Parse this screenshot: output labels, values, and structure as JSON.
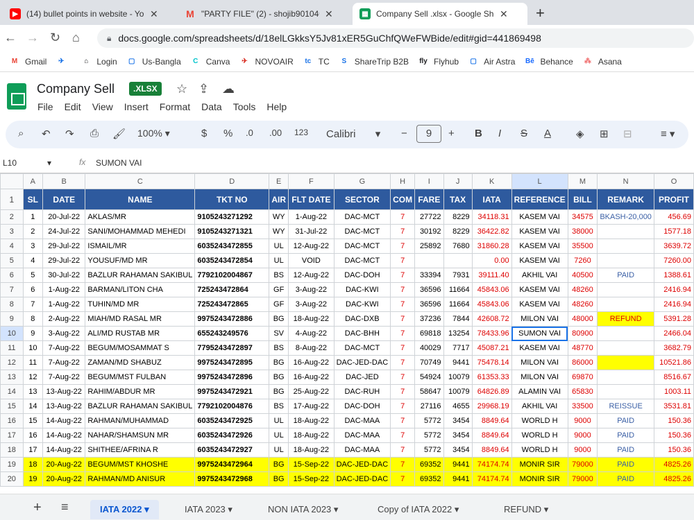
{
  "browser": {
    "tabs": [
      {
        "title": "(14) bullet points in website - Yo",
        "color": "#ff0000",
        "icon": "youtube-icon",
        "glyph": "▶"
      },
      {
        "title": "\"PARTY FILE\" (2) - shojib9010400",
        "color": "#ea4335",
        "icon": "gmail-icon",
        "glyph": "M"
      },
      {
        "title": "Company Sell .xlsx - Google She",
        "color": "#0f9d58",
        "icon": "sheets-icon",
        "glyph": "▦"
      }
    ],
    "url": "docs.google.com/spreadsheets/d/18elLGkksY5Jv81xER5GuChfQWeFWBide/edit#gid=441869498",
    "bookmarks": [
      {
        "label": "Gmail",
        "glyph": "M",
        "color": "#ea4335"
      },
      {
        "label": "",
        "glyph": "✈",
        "color": "#1a73e8"
      },
      {
        "label": "Login",
        "glyph": "⌂",
        "color": "#202124"
      },
      {
        "label": "Us-Bangla",
        "glyph": "▢",
        "color": "#1a73e8"
      },
      {
        "label": "Canva",
        "glyph": "C",
        "color": "#00c4cc"
      },
      {
        "label": "NOVOAIR",
        "glyph": "✈",
        "color": "#d93025"
      },
      {
        "label": "TC",
        "glyph": "tc",
        "color": "#1a73e8"
      },
      {
        "label": "ShareTrip B2B",
        "glyph": "S",
        "color": "#1a73e8"
      },
      {
        "label": "Flyhub",
        "glyph": "fly",
        "color": "#202124"
      },
      {
        "label": "Air Astra",
        "glyph": "▢",
        "color": "#1a73e8"
      },
      {
        "label": "Behance",
        "glyph": "Bē",
        "color": "#1769ff"
      },
      {
        "label": "Asana",
        "glyph": "⁂",
        "color": "#f06a6a"
      }
    ]
  },
  "doc": {
    "title": "Company Sell",
    "badge": ".XLSX",
    "menu": [
      "File",
      "Edit",
      "View",
      "Insert",
      "Format",
      "Data",
      "Tools",
      "Help"
    ]
  },
  "toolbar": {
    "zoom": "100%",
    "currency": "$",
    "percent": "%",
    "dec_less": ".0",
    "dec_more": ".00",
    "format_123": "123",
    "font": "Calibri",
    "font_size": "9"
  },
  "formula_bar": {
    "cell_ref": "L10",
    "fx": "fx",
    "value": "SUMON VAI"
  },
  "sheet": {
    "columns": [
      "A",
      "B",
      "C",
      "D",
      "E",
      "F",
      "G",
      "H",
      "I",
      "J",
      "K",
      "L",
      "M",
      "N",
      "O"
    ],
    "header_row": [
      "SL",
      "DATE",
      "NAME",
      "TKT NO",
      "AIR",
      "FLT DATE",
      "SECTOR",
      "COM",
      "FARE",
      "TAX",
      "IATA",
      "REFERENCE",
      "BILL",
      "REMARK",
      "PROFIT"
    ],
    "rows": [
      {
        "n": "2",
        "sl": "1",
        "date": "20-Jul-22",
        "name": "AKLAS/MR",
        "tkt": "9105243271292",
        "air": "WY",
        "flt": "1-Aug-22",
        "sector": "DAC-MCT",
        "com": "7",
        "fare": "27722",
        "tax": "8229",
        "iata": "34118.31",
        "ref": "KASEM VAI",
        "bill": "34575",
        "remark": "BKASH-20,000",
        "profit": "456.69"
      },
      {
        "n": "3",
        "sl": "2",
        "date": "24-Jul-22",
        "name": "SANI/MOHAMMAD MEHEDI",
        "tkt": "9105243271321",
        "air": "WY",
        "flt": "31-Jul-22",
        "sector": "DAC-MCT",
        "com": "7",
        "fare": "30192",
        "tax": "8229",
        "iata": "36422.82",
        "ref": "KASEM VAI",
        "bill": "38000",
        "remark": "",
        "profit": "1577.18"
      },
      {
        "n": "4",
        "sl": "3",
        "date": "29-Jul-22",
        "name": "ISMAIL/MR",
        "tkt": "6035243472855",
        "air": "UL",
        "flt": "12-Aug-22",
        "sector": "DAC-MCT",
        "com": "7",
        "fare": "25892",
        "tax": "7680",
        "iata": "31860.28",
        "ref": "KASEM VAI",
        "bill": "35500",
        "remark": "",
        "profit": "3639.72"
      },
      {
        "n": "5",
        "sl": "4",
        "date": "29-Jul-22",
        "name": "YOUSUF/MD MR",
        "tkt": "6035243472854",
        "air": "UL",
        "flt": "VOID",
        "sector": "DAC-MCT",
        "com": "7",
        "fare": "",
        "tax": "",
        "iata": "0.00",
        "ref": "KASEM VAI",
        "bill": "7260",
        "remark": "",
        "profit": "7260.00"
      },
      {
        "n": "6",
        "sl": "5",
        "date": "30-Jul-22",
        "name": "BAZLUR RAHAMAN SAKIBUL",
        "tkt": "7792102004867",
        "air": "BS",
        "flt": "12-Aug-22",
        "sector": "DAC-DOH",
        "com": "7",
        "fare": "33394",
        "tax": "7931",
        "iata": "39111.40",
        "ref": "AKHIL VAI",
        "bill": "40500",
        "remark": "PAID",
        "profit": "1388.61"
      },
      {
        "n": "7",
        "sl": "6",
        "date": "1-Aug-22",
        "name": "BARMAN/LITON CHA",
        "tkt": "725243472864",
        "air": "GF",
        "flt": "3-Aug-22",
        "sector": "DAC-KWI",
        "com": "7",
        "fare": "36596",
        "tax": "11664",
        "iata": "45843.06",
        "ref": "KASEM VAI",
        "bill": "48260",
        "remark": "",
        "profit": "2416.94"
      },
      {
        "n": "8",
        "sl": "7",
        "date": "1-Aug-22",
        "name": "TUHIN/MD MR",
        "tkt": "725243472865",
        "air": "GF",
        "flt": "3-Aug-22",
        "sector": "DAC-KWI",
        "com": "7",
        "fare": "36596",
        "tax": "11664",
        "iata": "45843.06",
        "ref": "KASEM VAI",
        "bill": "48260",
        "remark": "",
        "profit": "2416.94"
      },
      {
        "n": "9",
        "sl": "8",
        "date": "2-Aug-22",
        "name": "MIAH/MD RASAL MR",
        "tkt": "9975243472886",
        "air": "BG",
        "flt": "18-Aug-22",
        "sector": "DAC-DXB",
        "com": "7",
        "fare": "37236",
        "tax": "7844",
        "iata": "42608.72",
        "ref": "MILON VAI",
        "bill": "48000",
        "remark": "REFUND",
        "profit": "5391.28",
        "remark_yellow": true
      },
      {
        "n": "10",
        "sl": "9",
        "date": "3-Aug-22",
        "name": "ALI/MD RUSTAB MR",
        "tkt": "655243249576",
        "air": "SV",
        "flt": "4-Aug-22",
        "sector": "DAC-BHH",
        "com": "7",
        "fare": "69818",
        "tax": "13254",
        "iata": "78433.96",
        "ref": "SUMON VAI",
        "bill": "80900",
        "remark": "",
        "profit": "2466.04",
        "selected": true
      },
      {
        "n": "11",
        "sl": "10",
        "date": "7-Aug-22",
        "name": "BEGUM/MOSAMMAT S",
        "tkt": "7795243472897",
        "air": "BS",
        "flt": "8-Aug-22",
        "sector": "DAC-MCT",
        "com": "7",
        "fare": "40029",
        "tax": "7717",
        "iata": "45087.21",
        "ref": "KASEM VAI",
        "bill": "48770",
        "remark": "",
        "profit": "3682.79"
      },
      {
        "n": "12",
        "sl": "11",
        "date": "7-Aug-22",
        "name": "ZAMAN/MD SHABUZ",
        "tkt": "9975243472895",
        "air": "BG",
        "flt": "16-Aug-22",
        "sector": "DAC-JED-DAC",
        "com": "7",
        "fare": "70749",
        "tax": "9441",
        "iata": "75478.14",
        "ref": "MILON VAI",
        "bill": "86000",
        "remark": "",
        "profit": "10521.86",
        "remark_yellow": true
      },
      {
        "n": "13",
        "sl": "12",
        "date": "7-Aug-22",
        "name": "BEGUM/MST FULBAN",
        "tkt": "9975243472896",
        "air": "BG",
        "flt": "16-Aug-22",
        "sector": "DAC-JED",
        "com": "7",
        "fare": "54924",
        "tax": "10079",
        "iata": "61353.33",
        "ref": "MILON VAI",
        "bill": "69870",
        "remark": "",
        "profit": "8516.67"
      },
      {
        "n": "14",
        "sl": "13",
        "date": "13-Aug-22",
        "name": "RAHIM/ABDUR MR",
        "tkt": "9975243472921",
        "air": "BG",
        "flt": "25-Aug-22",
        "sector": "DAC-RUH",
        "com": "7",
        "fare": "58647",
        "tax": "10079",
        "iata": "64826.89",
        "ref": "ALAMIN VAI",
        "bill": "65830",
        "remark": "",
        "profit": "1003.11"
      },
      {
        "n": "15",
        "sl": "14",
        "date": "13-Aug-22",
        "name": "BAZLUR RAHAMAN SAKIBUL",
        "tkt": "7792102004876",
        "air": "BS",
        "flt": "17-Aug-22",
        "sector": "DAC-DOH",
        "com": "7",
        "fare": "27116",
        "tax": "4655",
        "iata": "29968.19",
        "ref": "AKHIL VAI",
        "bill": "33500",
        "remark": "REISSUE",
        "profit": "3531.81"
      },
      {
        "n": "16",
        "sl": "15",
        "date": "14-Aug-22",
        "name": "RAHMAN/MUHAMMAD",
        "tkt": "6035243472925",
        "air": "UL",
        "flt": "18-Aug-22",
        "sector": "DAC-MAA",
        "com": "7",
        "fare": "5772",
        "tax": "3454",
        "iata": "8849.64",
        "ref": "WORLD H",
        "bill": "9000",
        "remark": "PAID",
        "profit": "150.36"
      },
      {
        "n": "17",
        "sl": "16",
        "date": "14-Aug-22",
        "name": "NAHAR/SHAMSUN MR",
        "tkt": "6035243472926",
        "air": "UL",
        "flt": "18-Aug-22",
        "sector": "DAC-MAA",
        "com": "7",
        "fare": "5772",
        "tax": "3454",
        "iata": "8849.64",
        "ref": "WORLD H",
        "bill": "9000",
        "remark": "PAID",
        "profit": "150.36"
      },
      {
        "n": "18",
        "sl": "17",
        "date": "14-Aug-22",
        "name": "SHITHEE/AFRINA R",
        "tkt": "6035243472927",
        "air": "UL",
        "flt": "18-Aug-22",
        "sector": "DAC-MAA",
        "com": "7",
        "fare": "5772",
        "tax": "3454",
        "iata": "8849.64",
        "ref": "WORLD H",
        "bill": "9000",
        "remark": "PAID",
        "profit": "150.36"
      },
      {
        "n": "19",
        "sl": "18",
        "date": "20-Aug-22",
        "name": "BEGUM/MST KHOSHE",
        "tkt": "9975243472964",
        "air": "BG",
        "flt": "15-Sep-22",
        "sector": "DAC-JED-DAC",
        "com": "7",
        "fare": "69352",
        "tax": "9441",
        "iata": "74174.74",
        "ref": "MONIR SIR",
        "bill": "79000",
        "remark": "PAID",
        "profit": "4825.26",
        "highlight": true
      },
      {
        "n": "20",
        "sl": "19",
        "date": "20-Aug-22",
        "name": "RAHMAN/MD ANISUR",
        "tkt": "9975243472968",
        "air": "BG",
        "flt": "15-Sep-22",
        "sector": "DAC-JED-DAC",
        "com": "7",
        "fare": "69352",
        "tax": "9441",
        "iata": "74174.74",
        "ref": "MONIR SIR",
        "bill": "79000",
        "remark": "PAID",
        "profit": "4825.26",
        "highlight": true
      }
    ]
  },
  "sheet_tabs": [
    "IATA 2022",
    "IATA 2023",
    "NON IATA 2023",
    "Copy of IATA 2022",
    "REFUND"
  ],
  "colors": {
    "header_blue": "#2e5a9e",
    "highlight": "#ffff00",
    "red": "#dd0000"
  }
}
